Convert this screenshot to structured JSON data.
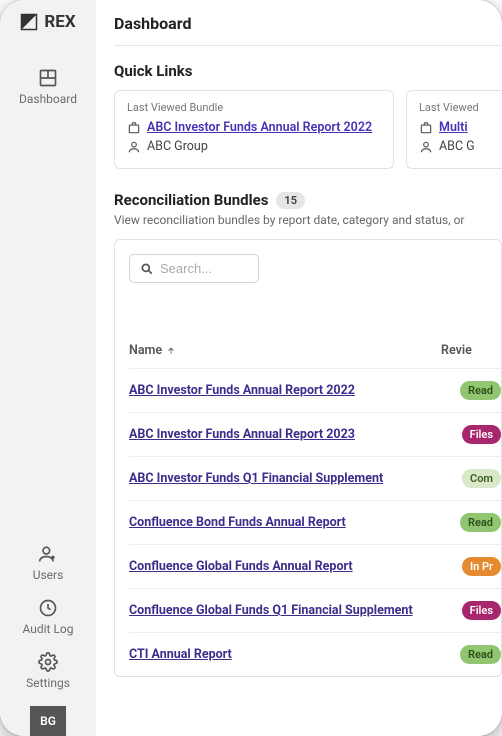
{
  "brand": {
    "name": "REX"
  },
  "sidebar": {
    "top": [
      {
        "label": "Dashboard"
      }
    ],
    "bottom": [
      {
        "label": "Users"
      },
      {
        "label": "Audit Log"
      },
      {
        "label": "Settings"
      }
    ],
    "avatar": "BG"
  },
  "page": {
    "title": "Dashboard"
  },
  "quickLinks": {
    "title": "Quick Links",
    "cards": [
      {
        "label": "Last Viewed Bundle",
        "link": "ABC Investor Funds Annual Report 2022",
        "org": "ABC Group"
      },
      {
        "label": "Last Viewed",
        "link": "Multi",
        "org": "ABC G"
      }
    ]
  },
  "recon": {
    "title": "Reconciliation Bundles",
    "count": "15",
    "subtitle": "View reconciliation bundles by report date, category and status, or",
    "search_placeholder": "Search...",
    "columns": {
      "name": "Name",
      "review": "Revie"
    },
    "rows": [
      {
        "name": "ABC Investor Funds Annual Report 2022",
        "status": "Read",
        "statusClass": "st-ready"
      },
      {
        "name": "ABC Investor Funds Annual Report 2023",
        "status": "Files",
        "statusClass": "st-files"
      },
      {
        "name": "ABC Investor Funds Q1 Financial Supplement",
        "status": "Com",
        "statusClass": "st-complete"
      },
      {
        "name": "Confluence Bond Funds Annual Report",
        "status": "Read",
        "statusClass": "st-ready"
      },
      {
        "name": "Confluence Global Funds Annual Report",
        "status": "In Pr",
        "statusClass": "st-inprog"
      },
      {
        "name": "Confluence Global Funds Q1 Financial Supplement",
        "status": "Files",
        "statusClass": "st-files"
      },
      {
        "name": "CTI Annual Report",
        "status": "Read",
        "statusClass": "st-ready"
      }
    ]
  }
}
